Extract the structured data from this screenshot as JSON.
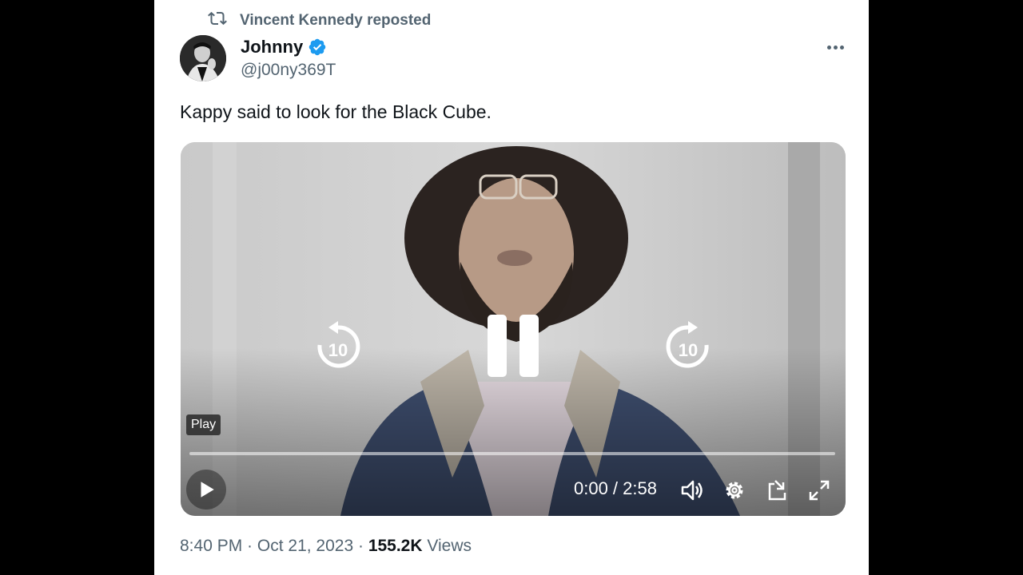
{
  "repost": {
    "text": "Vincent Kennedy reposted",
    "icon": "repost-icon"
  },
  "author": {
    "name": "Johnny",
    "handle": "@j00ny369T",
    "verified_color": "#1d9bf0"
  },
  "tweet": {
    "text": "Kappy said to look for the Black Cube."
  },
  "video": {
    "tooltip": "Play",
    "rewind_label": "10",
    "forward_label": "10",
    "time": "0:00 / 2:58",
    "progress": 0,
    "icons": [
      "play-icon",
      "pause-icon",
      "rewind-10-icon",
      "forward-10-icon",
      "volume-icon",
      "settings-icon",
      "pop-out-icon",
      "fullscreen-icon"
    ]
  },
  "meta": {
    "time": "8:40 PM",
    "separator": " · ",
    "date": "Oct 21, 2023",
    "views_count": "155.2K",
    "views_label": " Views"
  },
  "colors": {
    "text": "#0f1419",
    "muted": "#536471",
    "accent": "#1d9bf0"
  }
}
